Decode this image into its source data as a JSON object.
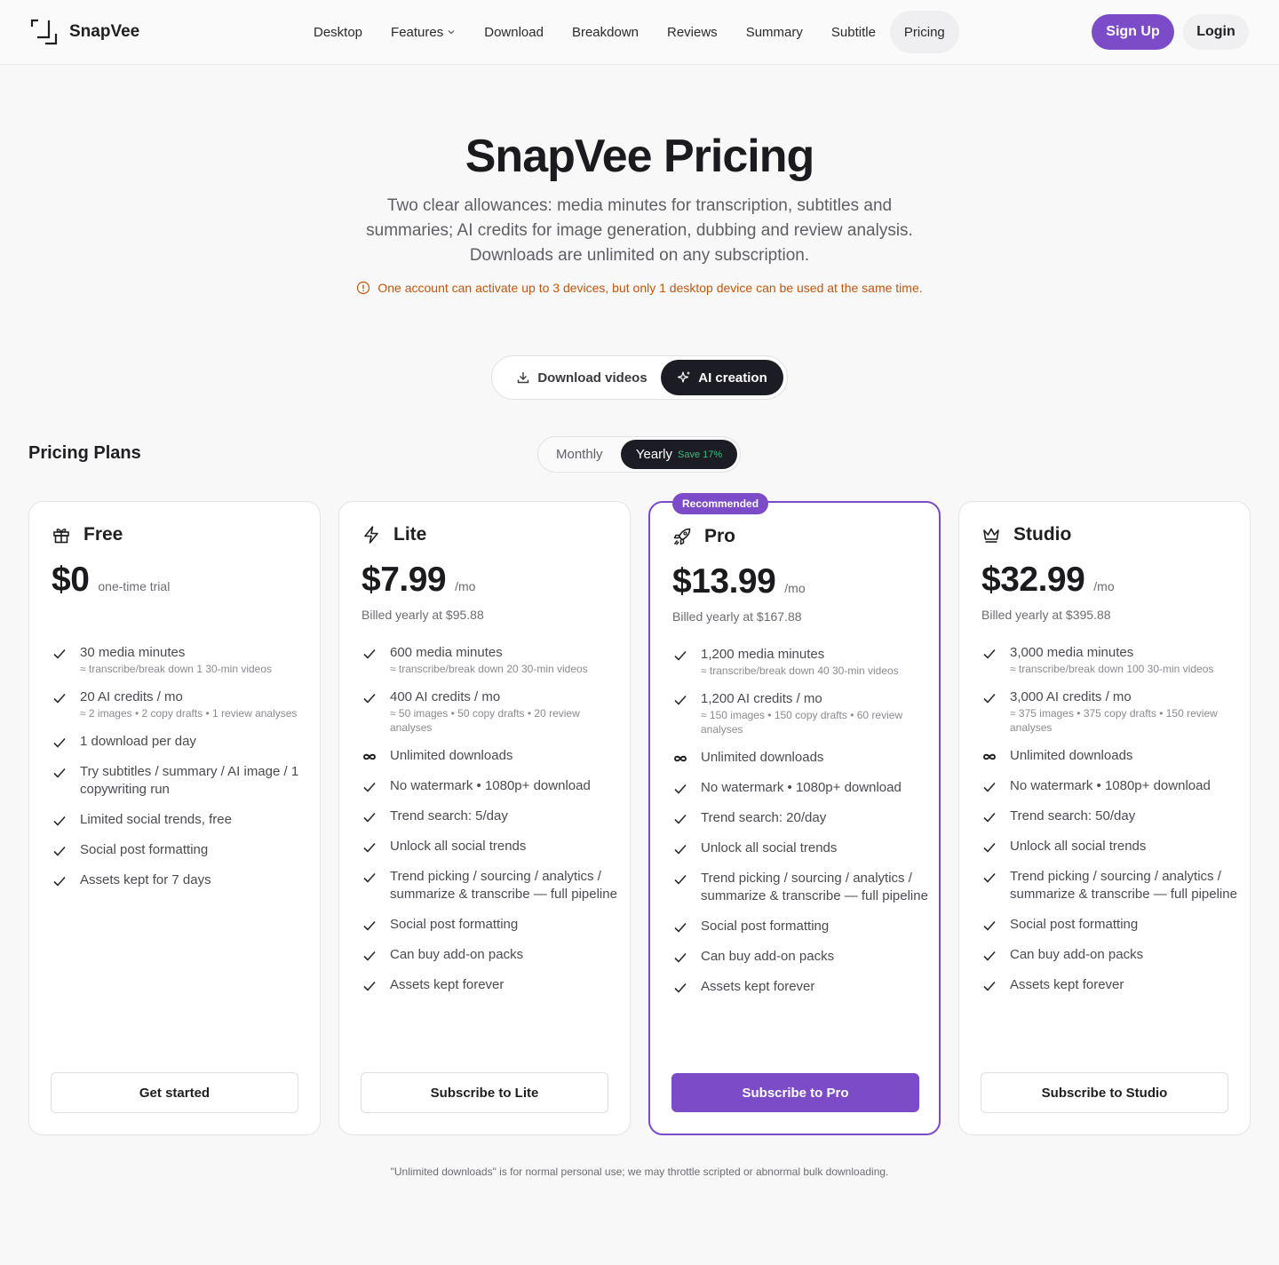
{
  "brand": {
    "name": "SnapVee"
  },
  "nav": {
    "items": [
      {
        "label": "Desktop"
      },
      {
        "label": "Features"
      },
      {
        "label": "Download"
      },
      {
        "label": "Breakdown"
      },
      {
        "label": "Reviews"
      },
      {
        "label": "Summary"
      },
      {
        "label": "Subtitle"
      },
      {
        "label": "Pricing"
      }
    ],
    "signup": "Sign Up",
    "login": "Login"
  },
  "hero": {
    "title": "SnapVee Pricing",
    "subtitle": "Two clear allowances: media minutes for transcription, subtitles and summaries; AI credits for image generation, dubbing and review analysis. Downloads are unlimited on any subscription.",
    "notice": "One account can activate up to 3 devices, but only 1 desktop device can be used at the same time."
  },
  "mode": {
    "download": "Download videos",
    "ai": "AI creation"
  },
  "plans_title": "Pricing Plans",
  "period": {
    "monthly": "Monthly",
    "yearly": "Yearly",
    "save": "Save 17%"
  },
  "colors": {
    "accent": "#7c4bc7",
    "dark": "#1c1c24",
    "notice": "#c2560c",
    "save": "#34c07a"
  },
  "plans": [
    {
      "icon": "gift-icon",
      "name": "Free",
      "price": "$0",
      "per": "one-time trial",
      "billed": "",
      "features": [
        {
          "icon": "check",
          "text": "30 media minutes",
          "sub": "≈ transcribe/break down 1 30-min videos"
        },
        {
          "icon": "check",
          "text": "20 AI credits / mo",
          "sub": "≈ 2 images  •  2 copy drafts  •  1 review analyses"
        },
        {
          "icon": "check",
          "text": "1 download per day",
          "sub": ""
        },
        {
          "icon": "check",
          "text": "Try subtitles / summary / AI image / 1 copywriting run",
          "sub": ""
        },
        {
          "icon": "check",
          "text": "Limited social trends, free",
          "sub": ""
        },
        {
          "icon": "check",
          "text": "Social post formatting",
          "sub": ""
        },
        {
          "icon": "check",
          "text": "Assets kept for 7 days",
          "sub": ""
        }
      ],
      "cta": "Get started"
    },
    {
      "icon": "bolt-icon",
      "name": "Lite",
      "price": "$7.99",
      "per": "/mo",
      "billed": "Billed yearly at $95.88",
      "features": [
        {
          "icon": "check",
          "text": "600 media minutes",
          "sub": "≈ transcribe/break down 20 30-min videos"
        },
        {
          "icon": "check",
          "text": "400 AI credits / mo",
          "sub": "≈ 50 images  •  50 copy drafts  •  20 review analyses"
        },
        {
          "icon": "infinity",
          "text": "Unlimited downloads",
          "sub": ""
        },
        {
          "icon": "check",
          "text": "No watermark  •  1080p+ download",
          "sub": ""
        },
        {
          "icon": "check",
          "text": "Trend search: 5/day",
          "sub": ""
        },
        {
          "icon": "check",
          "text": "Unlock all social trends",
          "sub": ""
        },
        {
          "icon": "check",
          "text": "Trend picking / sourcing / analytics / summarize & transcribe — full pipeline",
          "sub": ""
        },
        {
          "icon": "check",
          "text": "Social post formatting",
          "sub": ""
        },
        {
          "icon": "check",
          "text": "Can buy add-on packs",
          "sub": ""
        },
        {
          "icon": "check",
          "text": "Assets kept forever",
          "sub": ""
        }
      ],
      "cta": "Subscribe to Lite"
    },
    {
      "icon": "rocket-icon",
      "name": "Pro",
      "badge": "Recommended",
      "price": "$13.99",
      "per": "/mo",
      "billed": "Billed yearly at $167.88",
      "features": [
        {
          "icon": "check",
          "text": "1,200 media minutes",
          "sub": "≈ transcribe/break down 40 30-min videos"
        },
        {
          "icon": "check",
          "text": "1,200 AI credits / mo",
          "sub": "≈ 150 images  •  150 copy drafts  •  60 review analyses"
        },
        {
          "icon": "infinity",
          "text": "Unlimited downloads",
          "sub": ""
        },
        {
          "icon": "check",
          "text": "No watermark  •  1080p+ download",
          "sub": ""
        },
        {
          "icon": "check",
          "text": "Trend search: 20/day",
          "sub": ""
        },
        {
          "icon": "check",
          "text": "Unlock all social trends",
          "sub": ""
        },
        {
          "icon": "check",
          "text": "Trend picking / sourcing / analytics / summarize & transcribe — full pipeline",
          "sub": ""
        },
        {
          "icon": "check",
          "text": "Social post formatting",
          "sub": ""
        },
        {
          "icon": "check",
          "text": "Can buy add-on packs",
          "sub": ""
        },
        {
          "icon": "check",
          "text": "Assets kept forever",
          "sub": ""
        }
      ],
      "cta": "Subscribe to Pro"
    },
    {
      "icon": "crown-icon",
      "name": "Studio",
      "price": "$32.99",
      "per": "/mo",
      "billed": "Billed yearly at $395.88",
      "features": [
        {
          "icon": "check",
          "text": "3,000 media minutes",
          "sub": "≈ transcribe/break down 100 30-min videos"
        },
        {
          "icon": "check",
          "text": "3,000 AI credits / mo",
          "sub": "≈ 375 images  •  375 copy drafts  •  150 review analyses"
        },
        {
          "icon": "infinity",
          "text": "Unlimited downloads",
          "sub": ""
        },
        {
          "icon": "check",
          "text": "No watermark  •  1080p+ download",
          "sub": ""
        },
        {
          "icon": "check",
          "text": "Trend search: 50/day",
          "sub": ""
        },
        {
          "icon": "check",
          "text": "Unlock all social trends",
          "sub": ""
        },
        {
          "icon": "check",
          "text": "Trend picking / sourcing / analytics / summarize & transcribe — full pipeline",
          "sub": ""
        },
        {
          "icon": "check",
          "text": "Social post formatting",
          "sub": ""
        },
        {
          "icon": "check",
          "text": "Can buy add-on packs",
          "sub": ""
        },
        {
          "icon": "check",
          "text": "Assets kept forever",
          "sub": ""
        }
      ],
      "cta": "Subscribe to Studio"
    }
  ],
  "footnote": "\"Unlimited downloads\" is for normal personal use; we may throttle scripted or abnormal bulk downloading."
}
